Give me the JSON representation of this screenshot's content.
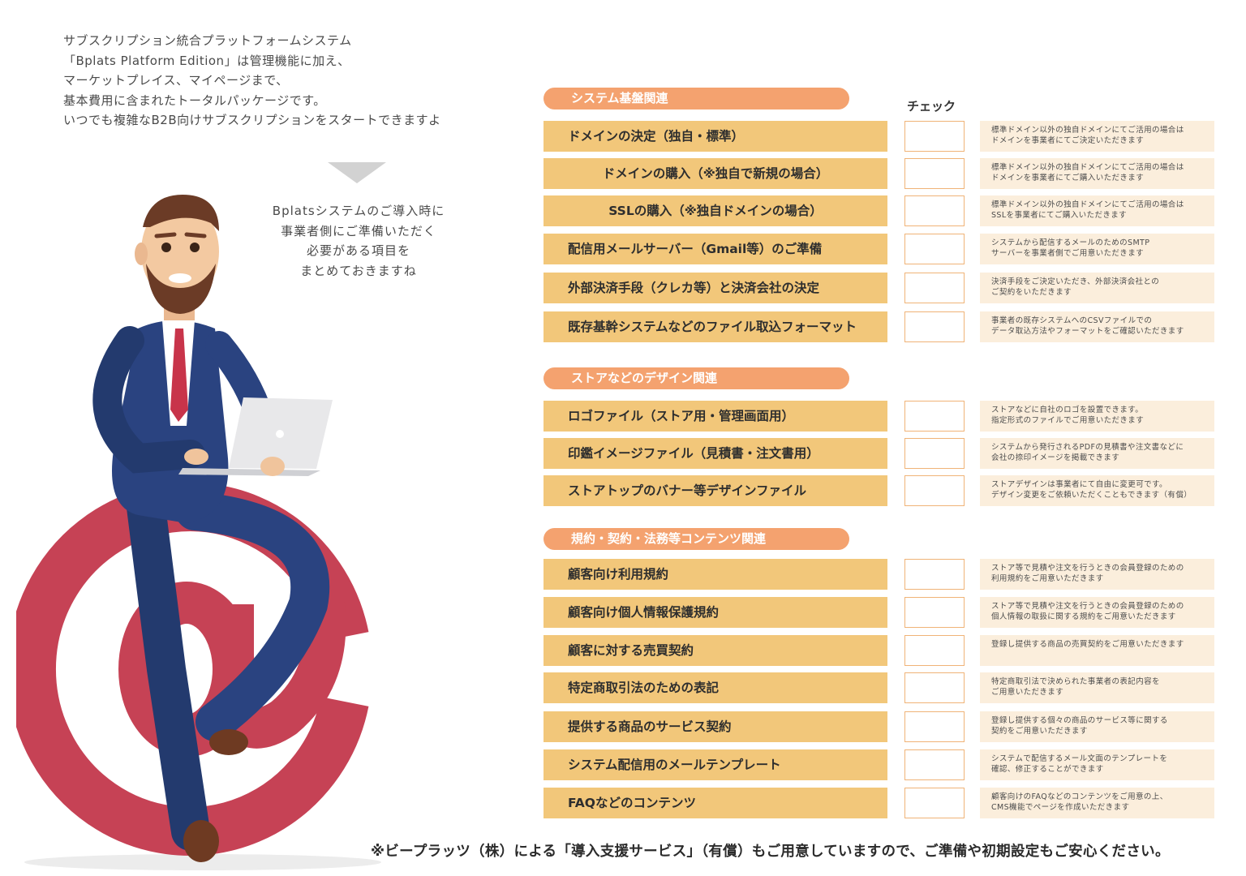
{
  "intro": {
    "lines": [
      "サブスクリプション統合プラットフォームシステム",
      "「Bplats Platform Edition」は管理機能に加え、",
      "マーケットプレイス、マイページまで、",
      "基本費用に含まれたトータルパッケージです。",
      "いつでも複雑なB2B向けサブスクリプションをスタートできますよ"
    ]
  },
  "speech": {
    "lines": [
      "Bplatsシステムのご導入時に",
      "事業者側にご準備いただく",
      "必要がある項目を",
      "まとめておきますね"
    ]
  },
  "check_header": "チェック",
  "sections": [
    {
      "title": "システム基盤関連",
      "items": [
        {
          "label": "ドメインの決定（独自・標準）",
          "note1": "標準ドメイン以外の独自ドメインにてご活用の場合は",
          "note2": "ドメインを事業者にてご決定いただきます"
        },
        {
          "label": "ドメインの購入（※独自で新規の場合）",
          "note1": "標準ドメイン以外の独自ドメインにてご活用の場合は",
          "note2": "ドメインを事業者にてご購入いただきます"
        },
        {
          "label": "SSLの購入（※独自ドメインの場合）",
          "note1": "標準ドメイン以外の独自ドメインにてご活用の場合は",
          "note2": "SSLを事業者にてご購入いただきます"
        },
        {
          "label": "配信用メールサーバー（Gmail等）のご準備",
          "note1": "システムから配信するメールのためのSMTP",
          "note2": "サーバーを事業者側でご用意いただきます"
        },
        {
          "label": "外部決済手段（クレカ等）と決済会社の決定",
          "note1": "決済手段をご決定いただき、外部決済会社との",
          "note2": "ご契約をいただきます"
        },
        {
          "label": "既存基幹システムなどのファイル取込フォーマット",
          "note1": "事業者の既存システムへのCSVファイルでの",
          "note2": "データ取込方法やフォーマットをご確認いただきます"
        }
      ]
    },
    {
      "title": "ストアなどのデザイン関連",
      "items": [
        {
          "label": "ロゴファイル（ストア用・管理画面用）",
          "note1": "ストアなどに自社のロゴを設置できます。",
          "note2": "指定形式のファイルでご用意いただきます"
        },
        {
          "label": "印鑑イメージファイル（見積書・注文書用）",
          "note1": "システムから発行されるPDFの見積書や注文書などに",
          "note2": "会社の捺印イメージを掲載できます"
        },
        {
          "label": "ストアトップのバナー等デザインファイル",
          "note1": "ストアデザインは事業者にて自由に変更可です。",
          "note2": "デザイン変更をご依頼いただくこともできます（有償）"
        }
      ]
    },
    {
      "title": "規約・契約・法務等コンテンツ関連",
      "items": [
        {
          "label": "顧客向け利用規約",
          "note1": "ストア等で見積や注文を行うときの会員登録のための",
          "note2": "利用規約をご用意いただきます"
        },
        {
          "label": "顧客向け個人情報保護規約",
          "note1": "ストア等で見積や注文を行うときの会員登録のための",
          "note2": "個人情報の取扱に関する規約をご用意いただきます"
        },
        {
          "label": "顧客に対する売買契約",
          "note1": "登録し提供する商品の売買契約をご用意いただきます",
          "note2": ""
        },
        {
          "label": "特定商取引法のための表記",
          "note1": "特定商取引法で決められた事業者の表記内容を",
          "note2": "ご用意いただきます"
        },
        {
          "label": "提供する商品のサービス契約",
          "note1": "登録し提供する個々の商品のサービス等に関する",
          "note2": "契約をご用意いただきます"
        },
        {
          "label": "システム配信用のメールテンプレート",
          "note1": "システムで配信するメール文面のテンプレートを",
          "note2": "確認、修正することができます"
        },
        {
          "label": "FAQなどのコンテンツ",
          "note1": "顧客向けのFAQなどのコンテンツをご用意の上、",
          "note2": "CMS機能でページを作成いただきます"
        }
      ]
    }
  ],
  "footer": "※ビープラッツ（株）による「導入支援サービス」（有償）もご用意していますので、ご準備や初期設定もご安心ください。"
}
